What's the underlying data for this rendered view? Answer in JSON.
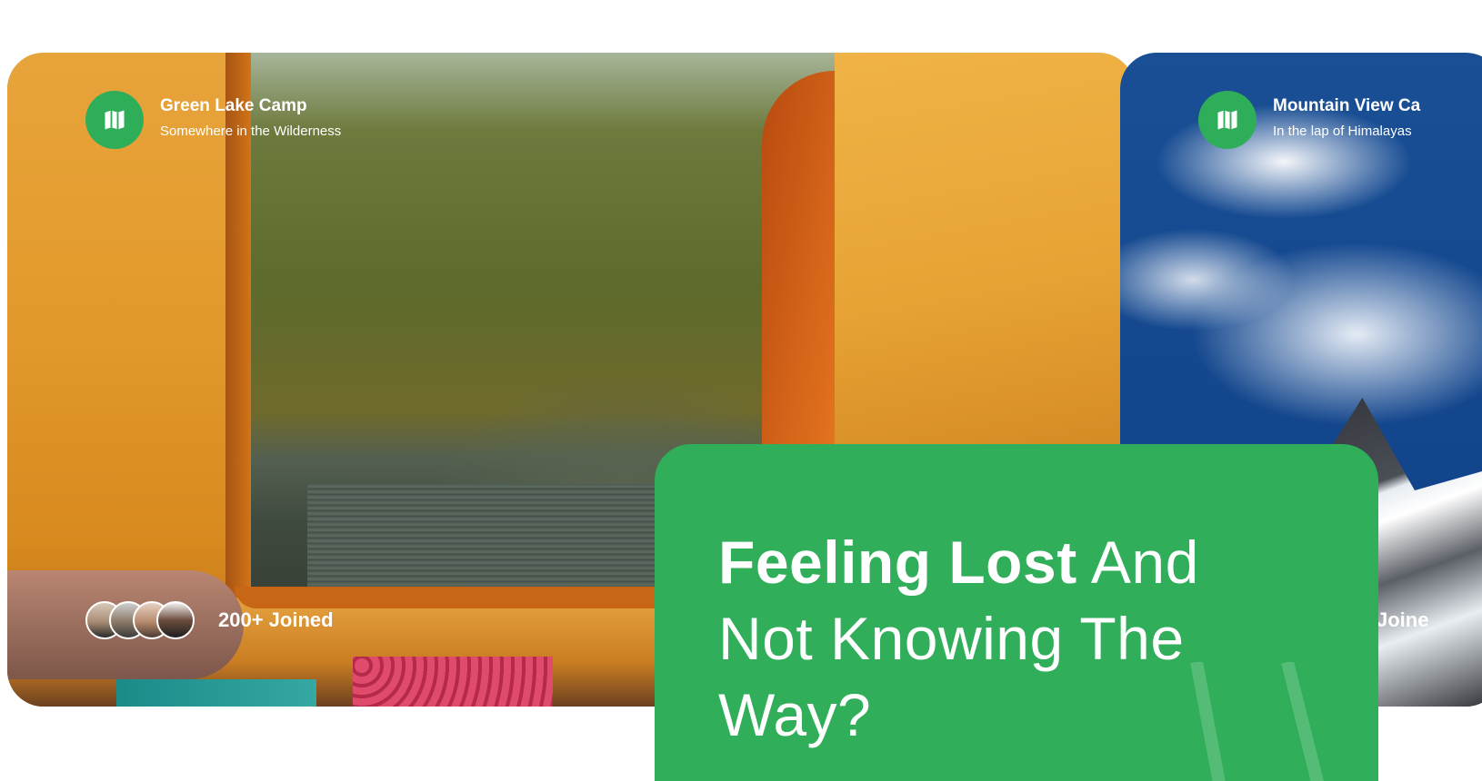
{
  "colors": {
    "brand_green": "#30ae59",
    "text_white": "#ffffff"
  },
  "cards": [
    {
      "title": "Green Lake Camp",
      "subtitle": "Somewhere in the Wilderness",
      "badge_icon": "map-icon",
      "joined_label": "200+ Joined",
      "avatars": [
        "avatar-1",
        "avatar-2",
        "avatar-3",
        "avatar-4"
      ]
    },
    {
      "title": "Mountain View Ca",
      "subtitle": "In the lap of Himalayas",
      "badge_icon": "map-icon",
      "joined_label": "Joine"
    }
  ],
  "promo": {
    "heading_strong": "Feeling Lost",
    "heading_rest_line1": " And",
    "heading_line2": "Not Knowing The",
    "heading_line3": "Way?"
  }
}
